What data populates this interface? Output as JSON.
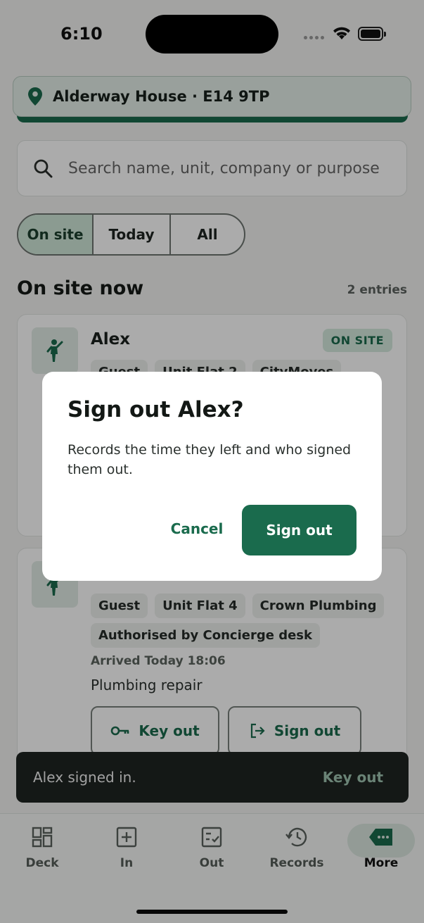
{
  "status_bar": {
    "time": "6:10"
  },
  "site": {
    "title": "Alderway House · E14 9TP"
  },
  "search": {
    "placeholder": "Search name, unit, company or purpose"
  },
  "filters": {
    "tabs": [
      {
        "label": "On site",
        "active": true
      },
      {
        "label": "Today",
        "active": false
      },
      {
        "label": "All",
        "active": false
      }
    ]
  },
  "section": {
    "title": "On site now",
    "count": "2 entries"
  },
  "cards": [
    {
      "name": "Alex",
      "badge": "ON SITE",
      "chips": [
        "Guest",
        "Unit Flat 2",
        "CityMoves"
      ]
    },
    {
      "chips": [
        "Guest",
        "Unit Flat 4",
        "Crown Plumbing"
      ],
      "authorised": "Authorised by Concierge desk",
      "arrived": "Arrived Today 18:06",
      "purpose": "Plumbing repair",
      "key_out_label": "Key out",
      "sign_out_label": "Sign out"
    }
  ],
  "toast": {
    "message": "Alex signed in.",
    "action": "Key out"
  },
  "tab_bar": {
    "items": [
      {
        "label": "Deck",
        "icon": "grid-icon"
      },
      {
        "label": "In",
        "icon": "plus-square-icon"
      },
      {
        "label": "Out",
        "icon": "checklist-icon"
      },
      {
        "label": "Records",
        "icon": "history-icon"
      },
      {
        "label": "More",
        "icon": "tag-more-icon",
        "active": true
      }
    ]
  },
  "dialog": {
    "title": "Sign out Alex?",
    "body": "Records the time they left and who signed them out.",
    "cancel_label": "Cancel",
    "confirm_label": "Sign out"
  },
  "colors": {
    "brand": "#1a6b4d",
    "badge_bg": "#d5ebdf",
    "toast_bg": "#1e2421"
  }
}
